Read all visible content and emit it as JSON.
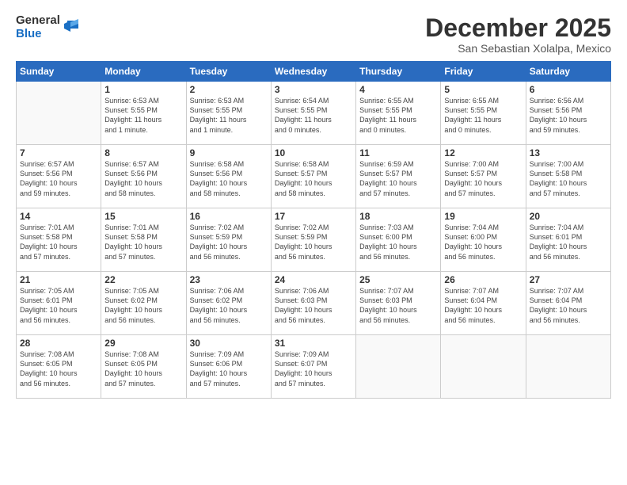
{
  "header": {
    "logo_general": "General",
    "logo_blue": "Blue",
    "month_title": "December 2025",
    "location": "San Sebastian Xolalpa, Mexico"
  },
  "weekdays": [
    "Sunday",
    "Monday",
    "Tuesday",
    "Wednesday",
    "Thursday",
    "Friday",
    "Saturday"
  ],
  "weeks": [
    [
      {
        "day": "",
        "info": ""
      },
      {
        "day": "1",
        "info": "Sunrise: 6:53 AM\nSunset: 5:55 PM\nDaylight: 11 hours\nand 1 minute."
      },
      {
        "day": "2",
        "info": "Sunrise: 6:53 AM\nSunset: 5:55 PM\nDaylight: 11 hours\nand 1 minute."
      },
      {
        "day": "3",
        "info": "Sunrise: 6:54 AM\nSunset: 5:55 PM\nDaylight: 11 hours\nand 0 minutes."
      },
      {
        "day": "4",
        "info": "Sunrise: 6:55 AM\nSunset: 5:55 PM\nDaylight: 11 hours\nand 0 minutes."
      },
      {
        "day": "5",
        "info": "Sunrise: 6:55 AM\nSunset: 5:55 PM\nDaylight: 11 hours\nand 0 minutes."
      },
      {
        "day": "6",
        "info": "Sunrise: 6:56 AM\nSunset: 5:56 PM\nDaylight: 10 hours\nand 59 minutes."
      }
    ],
    [
      {
        "day": "7",
        "info": "Sunrise: 6:57 AM\nSunset: 5:56 PM\nDaylight: 10 hours\nand 59 minutes."
      },
      {
        "day": "8",
        "info": "Sunrise: 6:57 AM\nSunset: 5:56 PM\nDaylight: 10 hours\nand 58 minutes."
      },
      {
        "day": "9",
        "info": "Sunrise: 6:58 AM\nSunset: 5:56 PM\nDaylight: 10 hours\nand 58 minutes."
      },
      {
        "day": "10",
        "info": "Sunrise: 6:58 AM\nSunset: 5:57 PM\nDaylight: 10 hours\nand 58 minutes."
      },
      {
        "day": "11",
        "info": "Sunrise: 6:59 AM\nSunset: 5:57 PM\nDaylight: 10 hours\nand 57 minutes."
      },
      {
        "day": "12",
        "info": "Sunrise: 7:00 AM\nSunset: 5:57 PM\nDaylight: 10 hours\nand 57 minutes."
      },
      {
        "day": "13",
        "info": "Sunrise: 7:00 AM\nSunset: 5:58 PM\nDaylight: 10 hours\nand 57 minutes."
      }
    ],
    [
      {
        "day": "14",
        "info": "Sunrise: 7:01 AM\nSunset: 5:58 PM\nDaylight: 10 hours\nand 57 minutes."
      },
      {
        "day": "15",
        "info": "Sunrise: 7:01 AM\nSunset: 5:58 PM\nDaylight: 10 hours\nand 57 minutes."
      },
      {
        "day": "16",
        "info": "Sunrise: 7:02 AM\nSunset: 5:59 PM\nDaylight: 10 hours\nand 56 minutes."
      },
      {
        "day": "17",
        "info": "Sunrise: 7:02 AM\nSunset: 5:59 PM\nDaylight: 10 hours\nand 56 minutes."
      },
      {
        "day": "18",
        "info": "Sunrise: 7:03 AM\nSunset: 6:00 PM\nDaylight: 10 hours\nand 56 minutes."
      },
      {
        "day": "19",
        "info": "Sunrise: 7:04 AM\nSunset: 6:00 PM\nDaylight: 10 hours\nand 56 minutes."
      },
      {
        "day": "20",
        "info": "Sunrise: 7:04 AM\nSunset: 6:01 PM\nDaylight: 10 hours\nand 56 minutes."
      }
    ],
    [
      {
        "day": "21",
        "info": "Sunrise: 7:05 AM\nSunset: 6:01 PM\nDaylight: 10 hours\nand 56 minutes."
      },
      {
        "day": "22",
        "info": "Sunrise: 7:05 AM\nSunset: 6:02 PM\nDaylight: 10 hours\nand 56 minutes."
      },
      {
        "day": "23",
        "info": "Sunrise: 7:06 AM\nSunset: 6:02 PM\nDaylight: 10 hours\nand 56 minutes."
      },
      {
        "day": "24",
        "info": "Sunrise: 7:06 AM\nSunset: 6:03 PM\nDaylight: 10 hours\nand 56 minutes."
      },
      {
        "day": "25",
        "info": "Sunrise: 7:07 AM\nSunset: 6:03 PM\nDaylight: 10 hours\nand 56 minutes."
      },
      {
        "day": "26",
        "info": "Sunrise: 7:07 AM\nSunset: 6:04 PM\nDaylight: 10 hours\nand 56 minutes."
      },
      {
        "day": "27",
        "info": "Sunrise: 7:07 AM\nSunset: 6:04 PM\nDaylight: 10 hours\nand 56 minutes."
      }
    ],
    [
      {
        "day": "28",
        "info": "Sunrise: 7:08 AM\nSunset: 6:05 PM\nDaylight: 10 hours\nand 56 minutes."
      },
      {
        "day": "29",
        "info": "Sunrise: 7:08 AM\nSunset: 6:05 PM\nDaylight: 10 hours\nand 57 minutes."
      },
      {
        "day": "30",
        "info": "Sunrise: 7:09 AM\nSunset: 6:06 PM\nDaylight: 10 hours\nand 57 minutes."
      },
      {
        "day": "31",
        "info": "Sunrise: 7:09 AM\nSunset: 6:07 PM\nDaylight: 10 hours\nand 57 minutes."
      },
      {
        "day": "",
        "info": ""
      },
      {
        "day": "",
        "info": ""
      },
      {
        "day": "",
        "info": ""
      }
    ]
  ]
}
